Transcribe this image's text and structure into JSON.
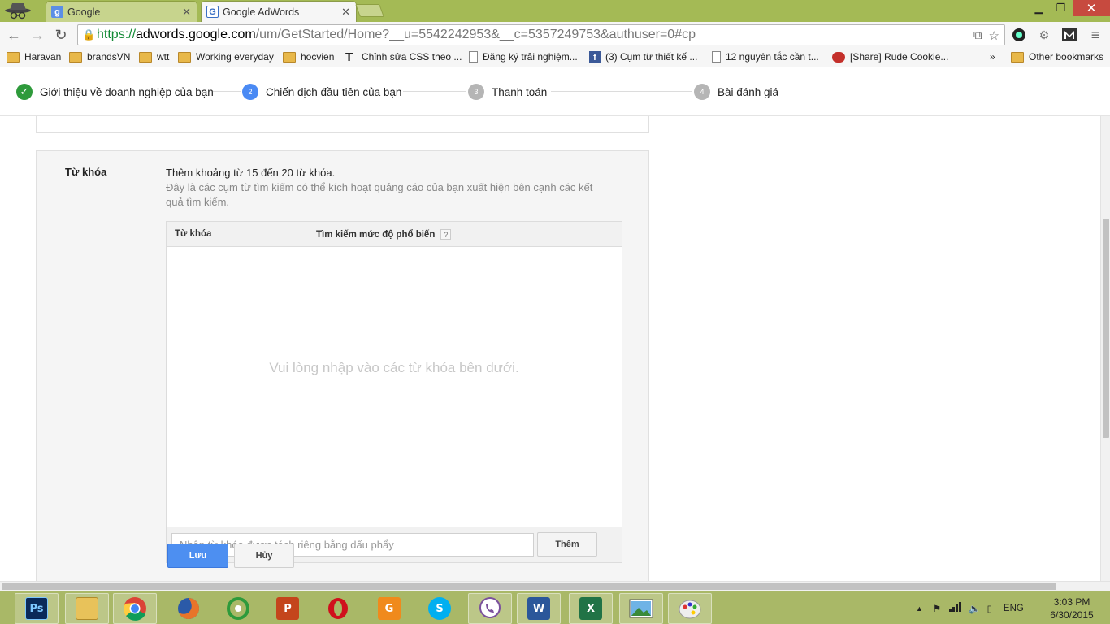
{
  "browser": {
    "tabs": [
      {
        "title": "Google",
        "favicon": "google-g-icon"
      },
      {
        "title": "Google AdWords",
        "favicon": "adwords-icon"
      }
    ],
    "url": {
      "scheme": "https://",
      "host": "adwords.google.com",
      "path": "/um/GetStarted/Home?__u=5542242953&__c=5357249753&authuser=0#cp"
    }
  },
  "bookmarks": [
    {
      "label": "Haravan",
      "icon": "folder-icon"
    },
    {
      "label": "brandsVN",
      "icon": "folder-icon"
    },
    {
      "label": "wtt",
      "icon": "folder-icon"
    },
    {
      "label": "Working everyday",
      "icon": "folder-icon"
    },
    {
      "label": "hocvien",
      "icon": "folder-icon"
    },
    {
      "label": "Chỉnh sửa CSS theo ...",
      "icon": "text-t-icon"
    },
    {
      "label": "Đăng ký trải nghiệm...",
      "icon": "page-icon"
    },
    {
      "label": "(3) Cụm từ thiết kế ...",
      "icon": "facebook-icon"
    },
    {
      "label": "12 nguyên tắc cần t...",
      "icon": "page-icon"
    },
    {
      "label": "[Share] Rude Cookie...",
      "icon": "youtube-icon"
    }
  ],
  "bookmarks_more": "»",
  "other_bookmarks": "Other bookmarks",
  "stepper": {
    "steps": [
      {
        "number": "✓",
        "label": "Giới thiệu về doanh nghiệp của bạn",
        "state": "done"
      },
      {
        "number": "2",
        "label": "Chiến dịch đầu tiên của bạn",
        "state": "current"
      },
      {
        "number": "3",
        "label": "Thanh toán",
        "state": "todo"
      },
      {
        "number": "4",
        "label": "Bài đánh giá",
        "state": "todo"
      }
    ]
  },
  "keywords": {
    "section_title": "Từ khóa",
    "intro": "Thêm khoảng từ 15 đến 20 từ khóa.",
    "description": "Đây là các cụm từ tìm kiếm có thể kích hoạt quảng cáo của bạn xuất hiện bên cạnh các kết quả tìm kiếm.",
    "table": {
      "col_keyword": "Từ khóa",
      "col_popularity": "Tìm kiếm mức độ phổ biến",
      "help": "?",
      "empty_message": "Vui lòng nhập vào các từ khóa bên dưới."
    },
    "input_placeholder": "Nhập từ khóa được tách riêng bằng dấu phẩy",
    "add_button": "Thêm",
    "save_button": "Lưu",
    "cancel_button": "Hủy"
  },
  "taskbar": {
    "apps": [
      {
        "name": "Photoshop",
        "label": "Ps",
        "color": "#0a2a5a"
      },
      {
        "name": "File Explorer",
        "label": "",
        "color": "#e8c25a"
      },
      {
        "name": "Chrome",
        "label": "",
        "color": "#ffffff"
      },
      {
        "name": "Firefox",
        "label": "",
        "color": "#e8742a"
      },
      {
        "name": "Coc Coc",
        "label": "",
        "color": "#2e9a3b"
      },
      {
        "name": "PowerPoint",
        "label": "P",
        "color": "#c4451c"
      },
      {
        "name": "Opera",
        "label": "O",
        "color": "#d0101c"
      },
      {
        "name": "Foxit PDF",
        "label": "G",
        "color": "#f08a1c"
      },
      {
        "name": "Skype",
        "label": "S",
        "color": "#00aff0"
      },
      {
        "name": "Viber",
        "label": "",
        "color": "#7b519d"
      },
      {
        "name": "Word",
        "label": "W",
        "color": "#2b579a"
      },
      {
        "name": "Excel",
        "label": "X",
        "color": "#217346"
      },
      {
        "name": "Photos",
        "label": "",
        "color": "#3a7fc4"
      },
      {
        "name": "Paint",
        "label": "",
        "color": "#e6e6e6"
      }
    ],
    "language": "ENG",
    "time": "3:03 PM",
    "date": "6/30/2015"
  }
}
